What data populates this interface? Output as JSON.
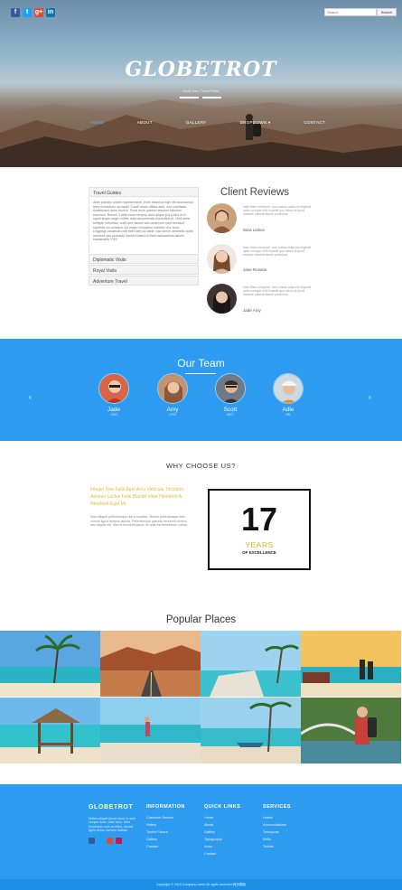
{
  "header": {
    "social": [
      {
        "icon": "facebook-icon",
        "glyph": "f",
        "color": "#3b5998"
      },
      {
        "icon": "twitter-icon",
        "glyph": "t",
        "color": "#1da1f2"
      },
      {
        "icon": "google-plus-icon",
        "glyph": "g+",
        "color": "#dd4b39"
      },
      {
        "icon": "linkedin-icon",
        "glyph": "in",
        "color": "#0e76a8"
      }
    ],
    "search_placeholder": "Search",
    "search_button": "Search",
    "logo": "GLOBETROT",
    "tagline": "Book Your Travel Pass",
    "nav": [
      "HOME",
      "ABOUT",
      "GALLERY",
      "DROPDOWN ▾",
      "CONTACT"
    ],
    "active_nav": "HOME"
  },
  "about": {
    "accordion_open": "Travel Guides",
    "accordion_body": "Anim pariatur cliche reprehenderit, enim eiusmod high life accusamus terry richardson ad squid. 3 wolf moon officia aute, non cupidatat skateboard dolor brunch. Food truck quinoa nesciunt laborum eiusmod. Brunch 3 wolf moon tempor, sunt aliqua put a bird on it squid single-origin coffee nulla assumenda shoreditch et. Nihil anim keffiyeh helvetica, craft beer labore wes anderson cred nesciunt sapiente ea proident. Ad vegan excepteur butcher vice lomo. Leggings occaecat craft beer farm-to-table, raw denim aesthetic synth nesciunt you probably haven't heard of them accusamus labore sustainable VHS.",
    "accordion_items": [
      "Diplomatic Visits",
      "Royal Visits",
      "Adventure Travel"
    ]
  },
  "reviews": {
    "title": "Client Reviews",
    "items": [
      {
        "text": "Nam libero tempore, cum soluta nobis est eligendi optio cumque nihil impedit quo minus id quod maxime placeat facere possimus.",
        "name": "Sara Lisbon"
      },
      {
        "text": "Nam libero tempore, cum soluta nobis est eligendi optio cumque nihil impedit quo minus id quod maxime placeat facere possimus.",
        "name": "Jane Rosarie"
      },
      {
        "text": "Nam libero tempore, cum soluta nobis est eligendi optio cumque nihil impedit quo minus id quod maxime placeat facere possimus.",
        "name": "Jade Amy"
      }
    ]
  },
  "team": {
    "title": "Our Team",
    "members": [
      {
        "name": "Jade",
        "role": "CEO"
      },
      {
        "name": "Amy",
        "role": "CFO"
      },
      {
        "name": "Scott",
        "role": "MKT"
      },
      {
        "name": "Adle",
        "role": "HR"
      }
    ]
  },
  "why": {
    "title": "WHY CHOOSE US?",
    "highlight": "Integer Non Felis Eget Arcu Vehicula Tincidunt. Aenean Luctus Felis Blandit Vitae Hendrerit A, Hendrerit Eget Mi.",
    "body": "Nam aliquet pellentesque nisl a sodales. Mauris pellentesque felis cursus ligula tempus lacinia. Pellentesque gravida hendrerit viverra, nec aliquet elit. Sed ut tincidunt lacus, sit quis est fermentum varius.",
    "years_number": "17",
    "years_label": "YEARS",
    "years_sub": "OF EXCELLENCE"
  },
  "places": {
    "title": "Popular Places"
  },
  "footer": {
    "logo": "GLOBETROT",
    "about_text": "Nullam aliquet ipsum diam, in ante semper dolor, vitae dolor. Nam fermentum ante ac tellus, laoreet ligula lectus. Aenean facilisis.",
    "social_colors": [
      "#3b5998",
      "#1da1f2",
      "#dd4b39",
      "#0e76a8"
    ],
    "columns": [
      {
        "heading": "INFORMATION",
        "links": [
          "Customer Service",
          "Hotels",
          "Tourist Places",
          "Gallery",
          "Contact"
        ]
      },
      {
        "heading": "QUICK LINKS",
        "links": [
          "Home",
          "About",
          "Gallery",
          "Typography",
          "Icons",
          "Contact"
        ]
      },
      {
        "heading": "SERVICES",
        "links": [
          "Hotels",
          "Accomodations",
          "Transports",
          "Malls",
          "Tickets"
        ]
      }
    ],
    "copyright": "Copyright © 2015 Company name All rights reserved.网页模板"
  }
}
